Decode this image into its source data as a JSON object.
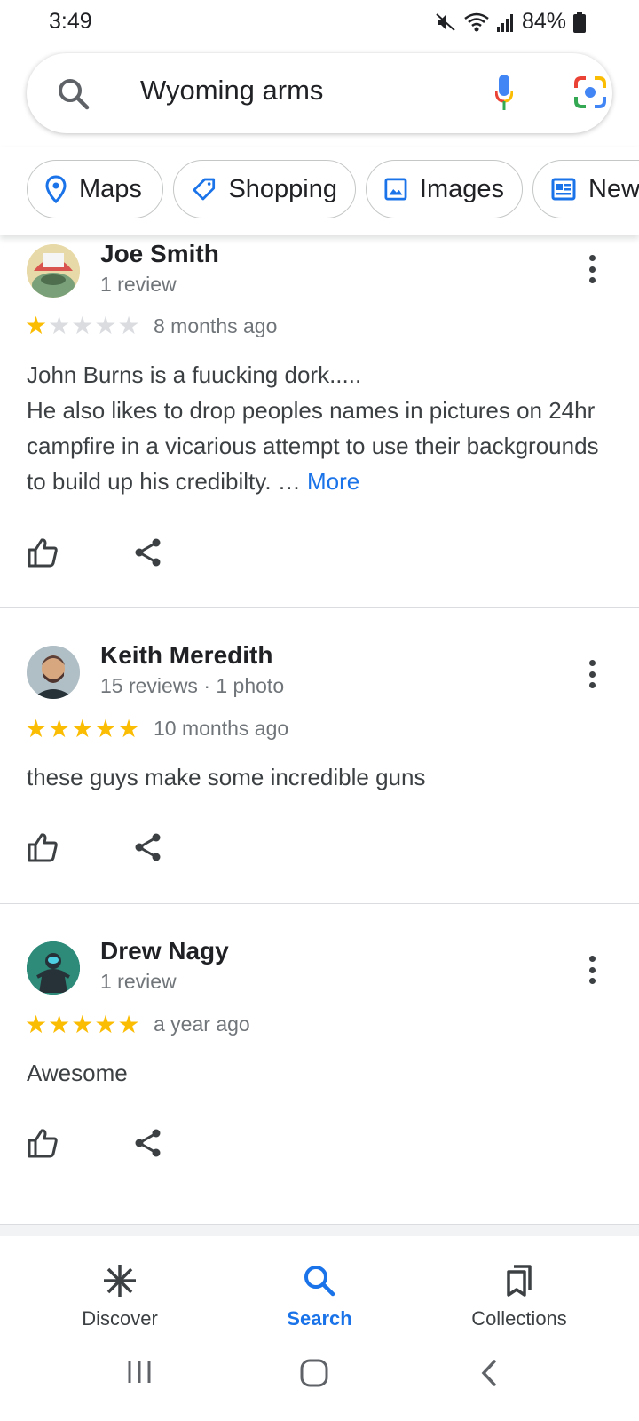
{
  "status_bar": {
    "time": "3:49",
    "battery": "84%"
  },
  "search": {
    "query": "Wyoming arms"
  },
  "chips": [
    {
      "label": "Maps",
      "icon": "map-pin-icon"
    },
    {
      "label": "Shopping",
      "icon": "tag-icon"
    },
    {
      "label": "Images",
      "icon": "image-icon"
    },
    {
      "label": "New",
      "icon": "news-icon"
    }
  ],
  "reviews": [
    {
      "name": "Joe Smith",
      "meta": "1 review",
      "rating": 1,
      "date": "8 months ago",
      "text_line1": "John Burns is a fuucking dork.....",
      "text_rest": "He also likes to drop peoples names in pictures on 24hr campfire in a vicarious attempt to use their backgrounds to build up his credibilty. …",
      "more": "More"
    },
    {
      "name": "Keith Meredith",
      "meta": "15 reviews · 1 photo",
      "rating": 5,
      "date": "10 months ago",
      "text": "these guys make some incredible guns"
    },
    {
      "name": "Drew Nagy",
      "meta": "1 review",
      "rating": 5,
      "date": "a year ago",
      "text": "Awesome"
    }
  ],
  "bottom_nav": [
    {
      "label": "Discover",
      "icon": "asterisk-icon",
      "active": false
    },
    {
      "label": "Search",
      "icon": "search-icon",
      "active": true
    },
    {
      "label": "Collections",
      "icon": "bookmark-icon",
      "active": false
    }
  ],
  "colors": {
    "accent": "#1a73e8",
    "star": "#fbbc04"
  }
}
